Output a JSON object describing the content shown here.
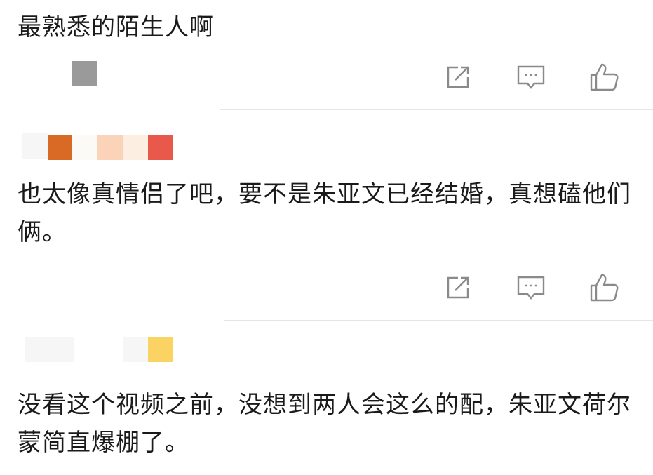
{
  "comments": [
    {
      "text": "最熟悉的陌生人啊",
      "avatar_colors": [
        "#9a9a9a"
      ]
    },
    {
      "text": "也太像真情侣了吧，要不是朱亚文已经结婚，真想磕他们俩。",
      "avatar_colors": [
        "#d96a25",
        "#fbd3b8",
        "#fdeee2",
        "#e8594c"
      ]
    },
    {
      "text": "没看这个视频之前，没想到两人会这么的配，朱亚文荷尔蒙简直爆棚了。",
      "avatar_colors": [
        "#fbd362"
      ]
    }
  ],
  "actions": {
    "share_icon": "share-icon",
    "comment_icon": "comment-icon",
    "like_icon": "thumbs-up-icon",
    "icon_color": "#8a8a8a"
  }
}
